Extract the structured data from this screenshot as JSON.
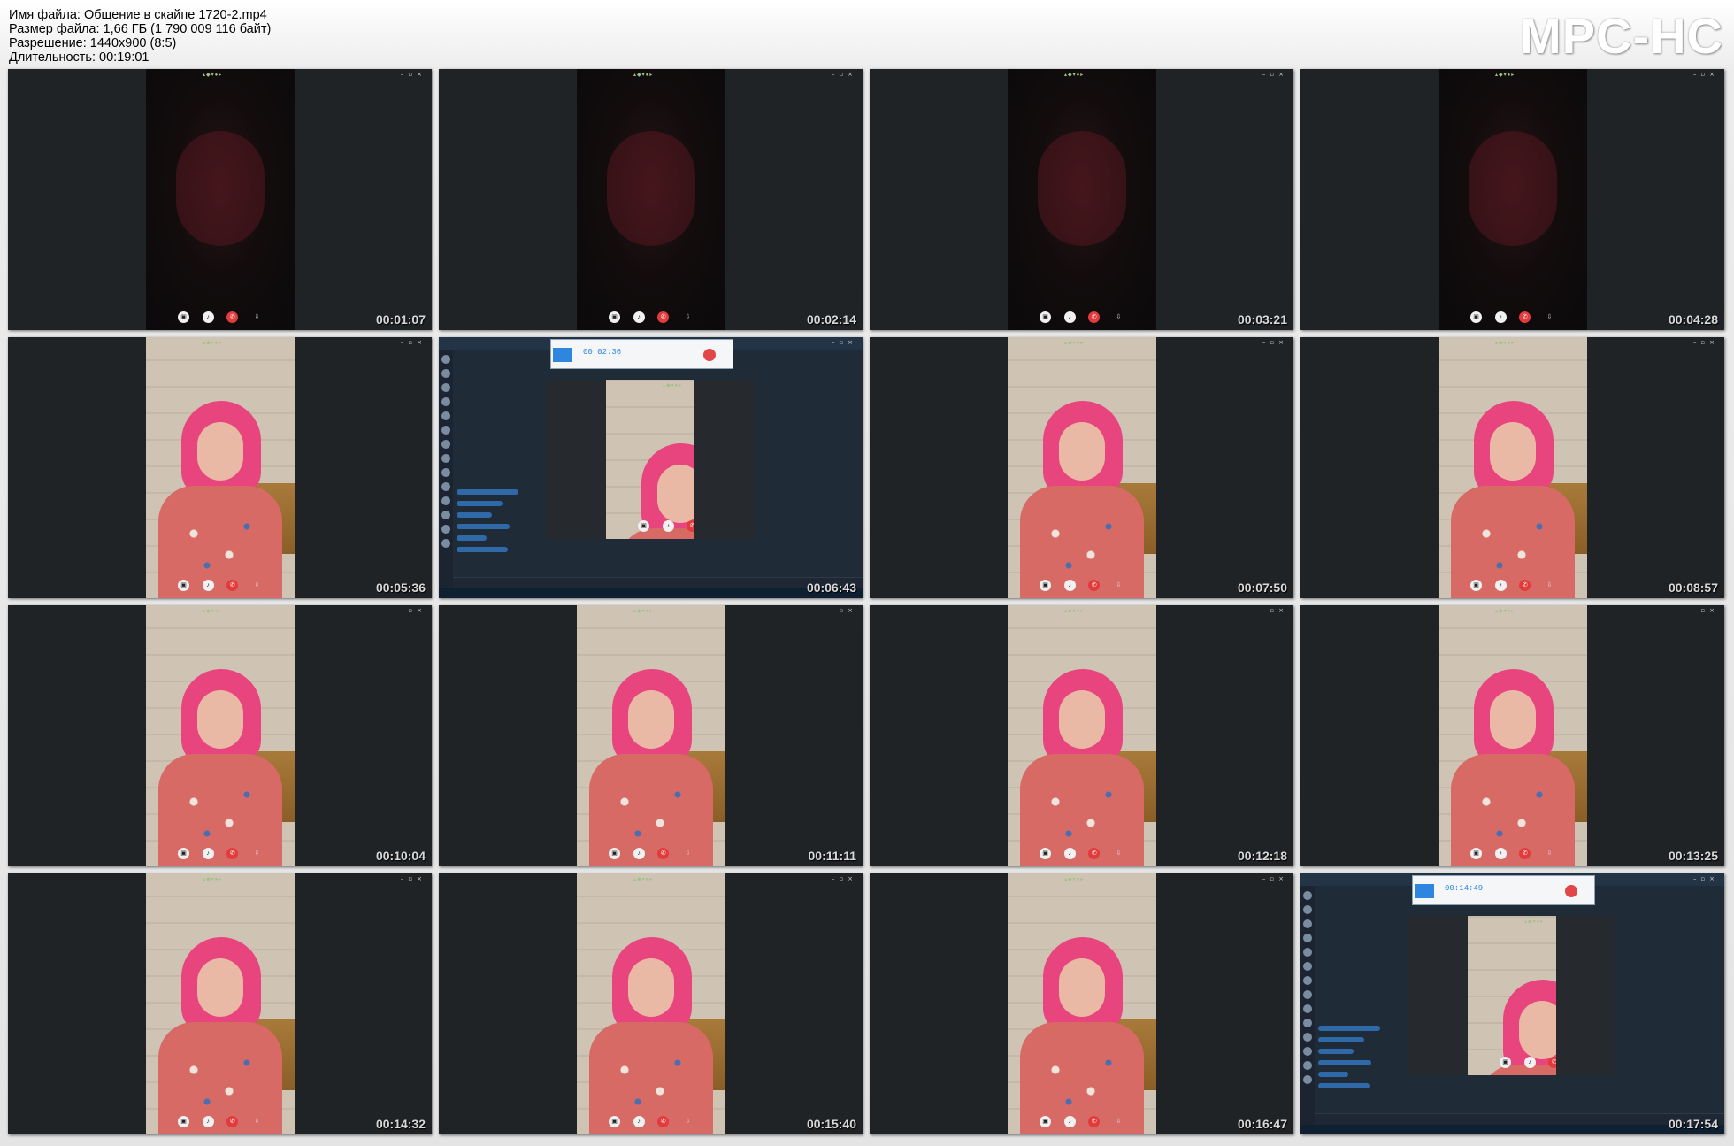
{
  "header": {
    "file_name": "Имя файла: Общение в скайпе 1720-2.mp4",
    "file_size": "Размер файла: 1,66 ГБ (1 790 009 116 байт)",
    "resolution": "Разрешение: 1440x900 (8:5)",
    "duration": "Длительность: 00:19:01"
  },
  "logo": "MPC-HC",
  "thumbnails": [
    {
      "time": "00:01:07",
      "scene": "dark"
    },
    {
      "time": "00:02:14",
      "scene": "dark"
    },
    {
      "time": "00:03:21",
      "scene": "dark"
    },
    {
      "time": "00:04:28",
      "scene": "dark"
    },
    {
      "time": "00:05:36",
      "scene": "lit"
    },
    {
      "time": "00:06:43",
      "scene": "skype"
    },
    {
      "time": "00:07:50",
      "scene": "lit"
    },
    {
      "time": "00:08:57",
      "scene": "lit"
    },
    {
      "time": "00:10:04",
      "scene": "lit"
    },
    {
      "time": "00:11:11",
      "scene": "lit"
    },
    {
      "time": "00:12:18",
      "scene": "lit"
    },
    {
      "time": "00:13:25",
      "scene": "lit"
    },
    {
      "time": "00:14:32",
      "scene": "lit"
    },
    {
      "time": "00:15:40",
      "scene": "lit"
    },
    {
      "time": "00:16:47",
      "scene": "lit"
    },
    {
      "time": "00:17:54",
      "scene": "skype"
    }
  ],
  "recorder": {
    "times": [
      "00:02:36",
      "00:14:49"
    ]
  },
  "colors": {
    "thumb_bg": "#202326",
    "hair": "#e8457e",
    "hangup": "#e23b3b",
    "skype_bg": "#202b38",
    "recorder_accent": "#2e86de"
  }
}
